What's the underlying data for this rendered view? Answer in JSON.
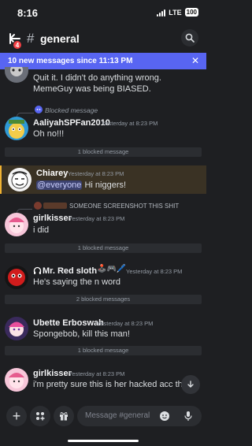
{
  "status": {
    "time": "8:16",
    "network": "LTE",
    "battery": "100"
  },
  "header": {
    "badge": "4",
    "hash": "#",
    "channel": "general",
    "chevron": "›"
  },
  "banner": {
    "text": "10 new messages since 11:13 PM",
    "close": "✕"
  },
  "messages": {
    "m0": {
      "text": "Quit it. I didn't do anything wrong. MemeGuy was being BIASED."
    },
    "m1": {
      "reply": "Blocked message",
      "author": "AaliyahSPFan2010",
      "time": "Yesterday at 8:23 PM",
      "text": "Oh no!!!"
    },
    "m2": {
      "author": "Chiarey",
      "time": "Yesterday at 8:23 PM",
      "mention": "@everyone",
      "text": "Hi niggers!"
    },
    "m3": {
      "reply": "SOMEONE SCREENSHOT THIS SHIT",
      "author": "girlkisser",
      "time": "Yesterday at 8:23 PM",
      "text": "i did"
    },
    "m4": {
      "author": "Mr. Red sloth",
      "author_decor": "🕹️🎮🖊️",
      "time": "Yesterday at 8:23 PM",
      "text": "He's saying the n word"
    },
    "m5": {
      "author": "Ubette Erboswah",
      "time": "Yesterday at 8:23 PM",
      "text": "Spongebob, kill this man!"
    },
    "m6": {
      "author": "girlkisser",
      "time": "Yesterday at 8:23 PM",
      "text": "i'm pretty sure this is her hacked acc tho"
    }
  },
  "blocked": {
    "b1": "1 blocked message",
    "b2": "1 blocked message",
    "b3": "2 blocked messages",
    "b4": "1 blocked message"
  },
  "composer": {
    "placeholder": "Message #general",
    "plus": "+"
  },
  "colors": {
    "accent": "#5865f2",
    "background": "#1e1f22",
    "mention_highlight": "#3a3224"
  },
  "icons": [
    "back-arrow-icon",
    "search-icon",
    "close-icon",
    "plus-icon",
    "apps-icon",
    "gift-icon",
    "emoji-icon",
    "microphone-icon",
    "arrow-down-icon",
    "headphones-icon"
  ]
}
